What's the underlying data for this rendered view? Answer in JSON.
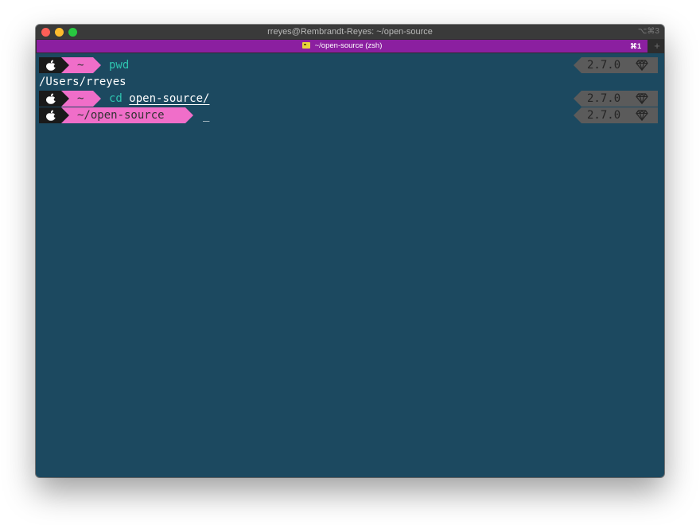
{
  "window": {
    "title": "rreyes@Rembrandt-Reyes: ~/open-source",
    "shortcut": "⌥⌘3"
  },
  "tab": {
    "label": "~/open-source (zsh)",
    "shortcut": "⌘1",
    "new_tab": "+"
  },
  "terminal": {
    "colors": {
      "background": "#1c4960",
      "prompt_pink": "#f06ec9",
      "command": "#2ec5b0",
      "right_prompt": "#5b5b5b"
    },
    "lines": [
      {
        "dir": "~",
        "command": "pwd",
        "arg": "",
        "ruby": "2.7.0",
        "ruby_icon": "gem-icon"
      },
      {
        "output": "/Users/rreyes"
      },
      {
        "dir": "~",
        "command": "cd",
        "arg": "open-source/",
        "ruby": "2.7.0",
        "ruby_icon": "gem-icon"
      },
      {
        "dir": "~/open-source",
        "command": "",
        "cursor": "_",
        "ruby": "2.7.0",
        "ruby_icon": "gem-icon"
      }
    ]
  }
}
